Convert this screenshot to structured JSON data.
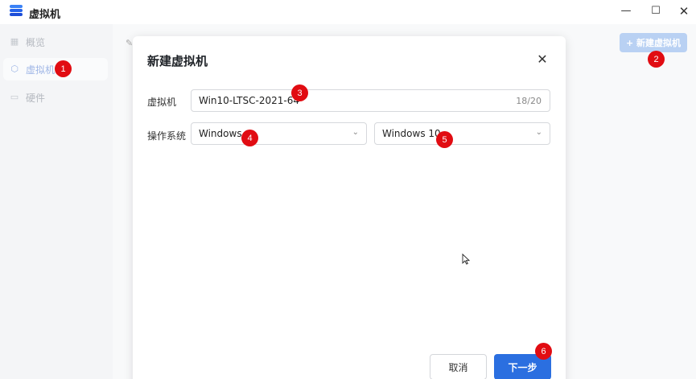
{
  "window": {
    "title": "虚拟机",
    "minimize_glyph": "—",
    "maximize_glyph": "☐",
    "close_glyph": "✕"
  },
  "sidebar": {
    "items": [
      {
        "label": "概览",
        "icon": "grid-icon",
        "glyph": "▦"
      },
      {
        "label": "虚拟机",
        "icon": "cube-icon",
        "glyph": "⬡",
        "active": true
      },
      {
        "label": "硬件",
        "icon": "drive-icon",
        "glyph": "▭"
      }
    ]
  },
  "toolbar": {
    "new_vm_label": "+ 新建虚拟机"
  },
  "dialog": {
    "title": "新建虚拟机",
    "close_glyph": "✕",
    "vm_name": {
      "label": "虚拟机",
      "value": "Win10-LTSC-2021-64",
      "counter": "18/20"
    },
    "os": {
      "label": "操作系统",
      "type_value": "Windows",
      "version_value": "Windows 10",
      "chevron": "⌄"
    },
    "cancel_label": "取消",
    "next_label": "下一步"
  },
  "badges": [
    "1",
    "2",
    "3",
    "4",
    "5",
    "6"
  ],
  "colors": {
    "accent": "#2b6fe0",
    "badge": "#e10c12",
    "disabled_button": "#b9d1f3"
  }
}
